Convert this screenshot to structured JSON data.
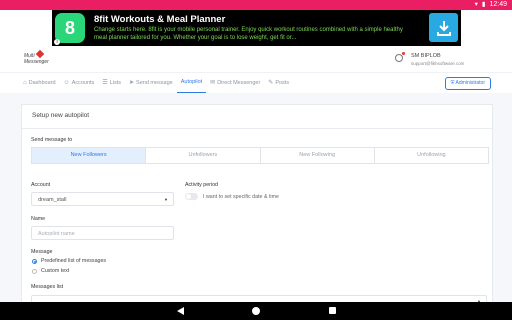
{
  "status_bar": {
    "time": "12:49",
    "color": "#e91e63"
  },
  "ad": {
    "title": "8fit Workouts & Meal Planner",
    "description": "Change starts here. 8fit is your mobile personal trainer. Enjoy quick workout routines combined with a simple healthy meal planner tailored for you. Whether your goal is to lose weight, get fit or...",
    "icon_glyph": "8",
    "download_icon": "download-icon",
    "info_glyph": "i"
  },
  "header": {
    "logo_line1": "Multi",
    "logo_line2": "Messenger",
    "user_name": "SM BIPLOB",
    "user_email": "support@fikhsoftware.com"
  },
  "nav": {
    "items": [
      {
        "icon": "⌂",
        "label": "Dashboard"
      },
      {
        "icon": "☺",
        "label": "Accounts"
      },
      {
        "icon": "☰",
        "label": "Lists"
      },
      {
        "icon": "➤",
        "label": "Send message"
      },
      {
        "icon": "",
        "label": "Autopilot"
      },
      {
        "icon": "✉",
        "label": "Direct Messenger"
      },
      {
        "icon": "✎",
        "label": "Posts"
      }
    ],
    "active_index": 4,
    "admin_label": "Administrator",
    "accent": "#2c7be5"
  },
  "form": {
    "title": "Setup new autopilot",
    "send_to_label": "Send message to",
    "send_to_options": [
      "New Followers",
      "Unfollowers",
      "New Following",
      "Unfollowing"
    ],
    "send_to_selected": "New Followers",
    "account_label": "Account",
    "account_value": "dream_stall",
    "activity_label": "Activity period",
    "activity_toggle_label": "I want to set specific date & time",
    "name_label": "Name",
    "name_placeholder": "Autopilot name",
    "message_label": "Message",
    "message_options": [
      "Predefined list of messages",
      "Custom text"
    ],
    "message_selected": "Predefined list of messages",
    "messages_list_label": "Messages list"
  }
}
